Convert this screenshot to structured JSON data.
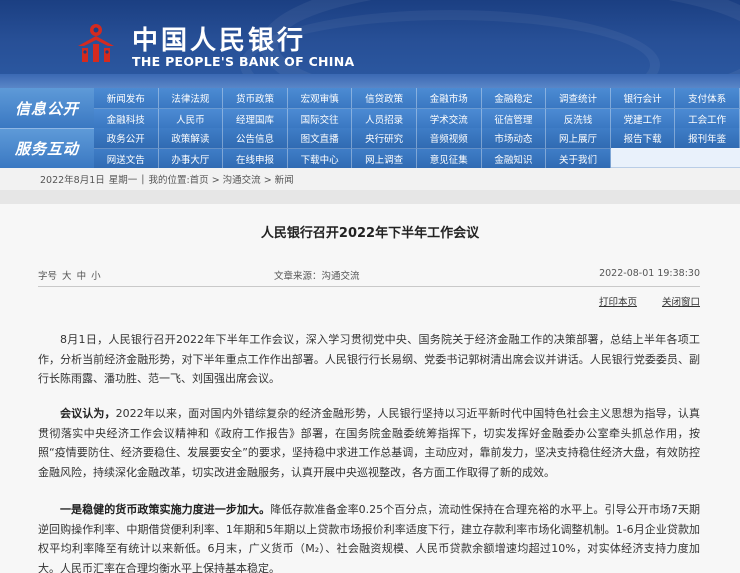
{
  "header": {
    "cn_name": "中国人民银行",
    "en_name": "THE PEOPLE'S BANK OF CHINA",
    "logo_icon": "pboc-logo-icon",
    "colors": {
      "banner": "#1b3f82",
      "nav": "#3a78c2",
      "logo_red": "#d42a1f"
    }
  },
  "nav": {
    "label_info": "信息公开",
    "label_service": "服务互动",
    "rows": [
      [
        "新闻发布",
        "法律法规",
        "货币政策",
        "宏观审慎",
        "信贷政策",
        "金融市场",
        "金融稳定",
        "调查统计",
        "银行会计"
      ],
      [
        "金融科技",
        "人民币",
        "经理国库",
        "国际交往",
        "人员招录",
        "学术交流",
        "征信管理",
        "反洗钱",
        "党建工作"
      ],
      [
        "政务公开",
        "政策解读",
        "公告信息",
        "图文直播",
        "央行研究",
        "音频视频",
        "市场动态",
        "网上展厅",
        "报告下载"
      ],
      [
        "网送文告",
        "办事大厅",
        "在线申报",
        "下载中心",
        "网上调查",
        "意见征集",
        "金融知识",
        "关于我们",
        ""
      ]
    ],
    "extra_row0": "支付体系",
    "extra_row1": "工会工作",
    "extra_row2": "报刊年鉴"
  },
  "breadcrumb": {
    "date": "2022年8月1日",
    "weekday": "星期一",
    "sep": "|",
    "location": "我的位置:首页 > 沟通交流 > 新闻"
  },
  "article": {
    "title": "人民银行召开2022年下半年工作会议",
    "font_size_label": "字号",
    "font_large": "大",
    "font_medium": "中",
    "font_small": "小",
    "source": "文章来源：沟通交流",
    "datetime": "2022-08-01 19:38:30",
    "print_label": "打印本页",
    "close_label": "关闭窗口",
    "p1": "8月1日，人民银行召开2022年下半年工作会议，深入学习贯彻党中央、国务院关于经济金融工作的决策部署，总结上半年各项工作，分析当前经济金融形势，对下半年重点工作作出部署。人民银行行长易纲、党委书记郭树清出席会议并讲话。人民银行党委委员、副行长陈雨露、潘功胜、范一飞、刘国强出席会议。",
    "p2_bold": "会议认为，",
    "p2": "2022年以来，面对国内外错综复杂的经济金融形势，人民银行坚持以习近平新时代中国特色社会主义思想为指导，认真贯彻落实中央经济工作会议精神和《政府工作报告》部署，在国务院金融委统筹指挥下，切实发挥好金融委办公室牵头抓总作用，按照“疫情要防住、经济要稳住、发展要安全”的要求，坚持稳中求进工作总基调，主动应对，靠前发力，坚决支持稳住经济大盘，有效防控金融风险，持续深化金融改革，切实改进金融服务，认真开展中央巡视整改，各方面工作取得了新的成效。",
    "p3_bold": "一是稳健的货币政策实施力度进一步加大。",
    "p3": "降低存款准备金率0.25个百分点，流动性保持在合理充裕的水平上。引导公开市场7天期逆回购操作利率、中期借贷便利利率、1年期和5年期以上贷款市场报价利率适度下行，建立存款利率市场化调整机制。1-6月企业贷款加权平均利率降至有统计以来新低。6月末，广义货币（M₂）、社会融资规模、人民币贷款余额增速均超过10%，对实体经济支持力度加大。人民币汇率在合理均衡水平上保持基本稳定。"
  }
}
